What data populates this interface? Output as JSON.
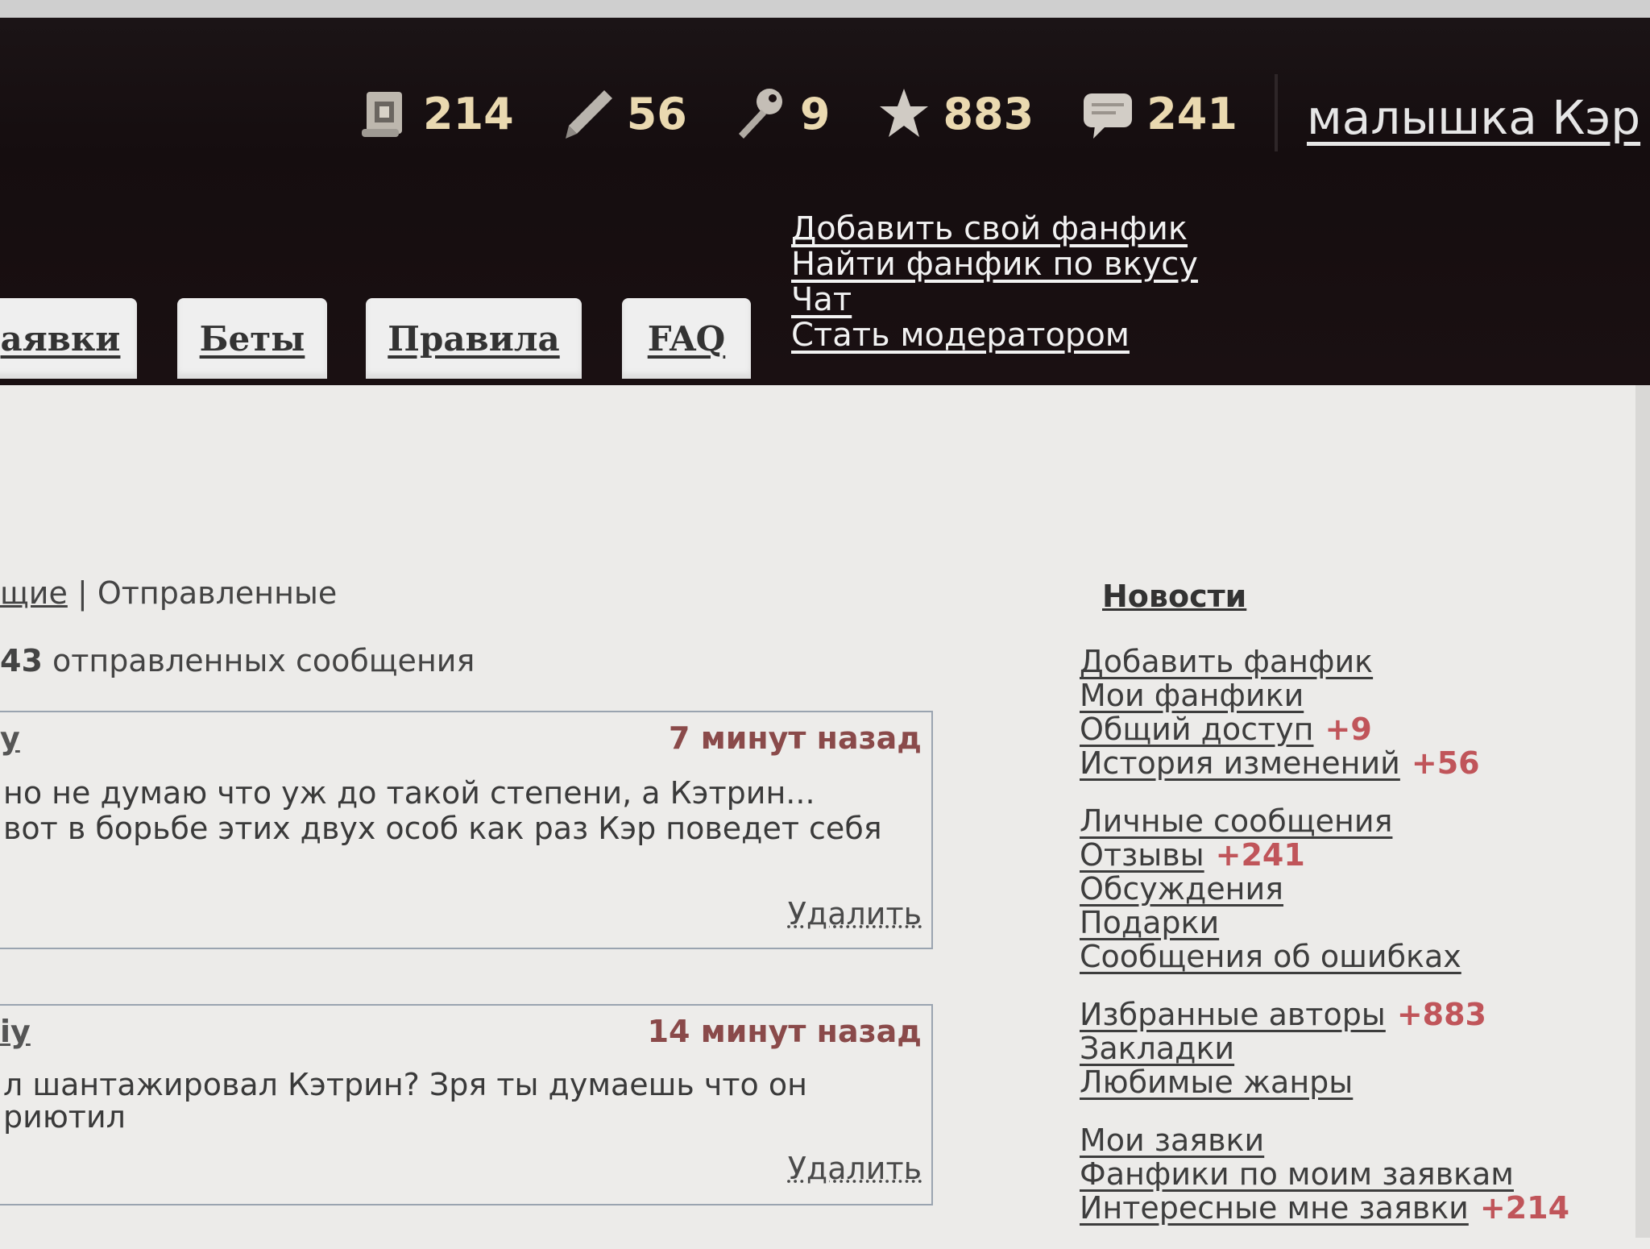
{
  "header": {
    "stats": [
      {
        "icon": "request-scroll-icon",
        "value": "214"
      },
      {
        "icon": "pencil-icon",
        "value": "56"
      },
      {
        "icon": "key-icon",
        "value": "9"
      },
      {
        "icon": "star-icon",
        "value": "883"
      },
      {
        "icon": "speech-bubble-icon",
        "value": "241"
      }
    ],
    "username": "малышка Кэр",
    "links": [
      "Добавить свой фанфик",
      "Найти фанфик по вкусу",
      "Чат",
      "Стать модератором"
    ],
    "tabs": [
      "аявки",
      "Беты",
      "Правила",
      "FAQ"
    ]
  },
  "messages": {
    "nav_inbox": "щие",
    "nav_sep": "|",
    "nav_sent": "Отправленные",
    "count_number": "43",
    "count_text": "отправленных сообщения",
    "items": [
      {
        "user": "у",
        "time": "7 минут назад",
        "line1": "но не думаю что уж до такой степени, а Кэтрин...",
        "line2": "вот в борьбе этих двух особ как раз Кэр поведет себя",
        "delete": "Удалить"
      },
      {
        "user": "iy",
        "time": "14 минут назад",
        "line1": "л шантажировал Кэтрин? Зря ты думаешь что он",
        "line2": "риютил",
        "delete": "Удалить"
      }
    ]
  },
  "sidebar": {
    "news": "Новости",
    "groups": [
      [
        {
          "label": "Добавить фанфик",
          "badge": ""
        },
        {
          "label": "Мои фанфики",
          "badge": ""
        },
        {
          "label": "Общий доступ",
          "badge": "+9"
        },
        {
          "label": "История изменений",
          "badge": "+56"
        }
      ],
      [
        {
          "label": "Личные сообщения",
          "badge": ""
        },
        {
          "label": "Отзывы",
          "badge": "+241"
        },
        {
          "label": "Обсуждения",
          "badge": ""
        },
        {
          "label": "Подарки",
          "badge": ""
        },
        {
          "label": "Сообщения об ошибках",
          "badge": ""
        }
      ],
      [
        {
          "label": "Избранные авторы",
          "badge": "+883"
        },
        {
          "label": "Закладки",
          "badge": ""
        },
        {
          "label": "Любимые жанры",
          "badge": ""
        }
      ],
      [
        {
          "label": "Мои заявки",
          "badge": ""
        },
        {
          "label": "Фанфики по моим заявкам",
          "badge": ""
        },
        {
          "label": "Интересные мне заявки",
          "badge": "+214"
        }
      ]
    ]
  },
  "colors": {
    "header_bg": "#150d0f",
    "stat_value": "#ead9b0",
    "badge": "#c0555a",
    "time": "#8a4a4a"
  }
}
